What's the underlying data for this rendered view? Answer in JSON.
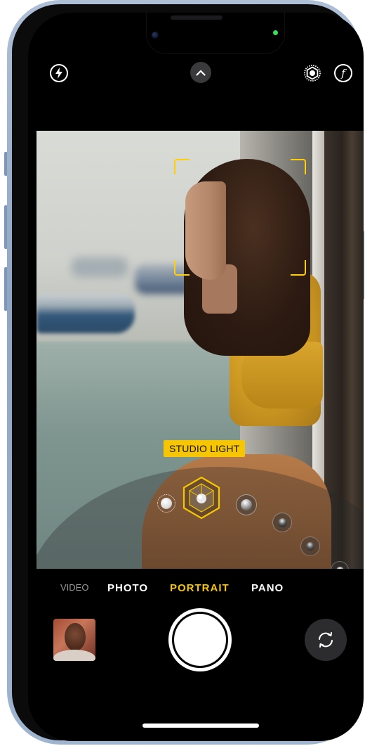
{
  "device": {
    "frame_color": "#9fb4cf"
  },
  "top_bar": {
    "flash_icon": "bolt-icon",
    "expand_icon": "chevron-up-icon",
    "live_photo_icon": "live-photo-icon",
    "depth_label": "f"
  },
  "viewfinder": {
    "lighting_effect_label": "STUDIO LIGHT",
    "lighting_options": [
      "natural-light",
      "studio-light",
      "contour-light",
      "stage-light",
      "stage-light-mono",
      "high-key-light-mono"
    ],
    "selected_lighting": "studio-light",
    "accent_color": "#f7c600"
  },
  "modes": {
    "video": "VIDEO",
    "photo": "PHOTO",
    "portrait": "PORTRAIT",
    "pano": "PANO",
    "selected": "PORTRAIT"
  },
  "bottom_bar": {
    "thumbnail_icon": "last-photo-thumbnail",
    "shutter_icon": "shutter-button",
    "flip_icon": "camera-flip-icon"
  }
}
